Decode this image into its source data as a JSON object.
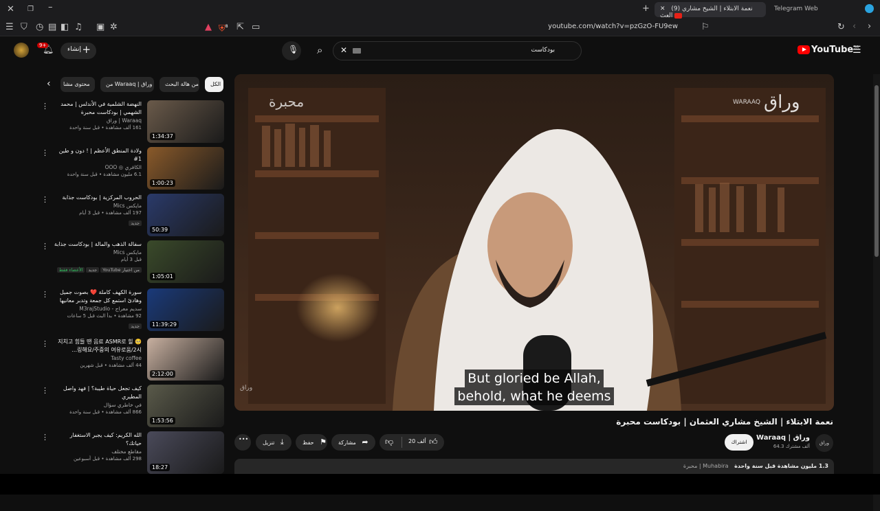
{
  "browser": {
    "tabs": [
      {
        "title": "(9) نعمة الابتلاء | الشيخ مشاري العث",
        "active": true
      },
      {
        "title": "Telegram Web",
        "active": false
      }
    ],
    "url": "youtube.com/watch?v=pzGzO-FU9ew",
    "brave_badge": "8"
  },
  "masthead": {
    "search_query": "بودكاست",
    "create_label": "إنشاء",
    "notif_count": "9+",
    "logo_text": "YouTube",
    "logo_region": "SA"
  },
  "chips": [
    "الكل",
    "من هالة البحث",
    "من Waraaq | وراق",
    "محتوى مشا"
  ],
  "related": [
    {
      "title": "النهضة الشلمية في الأندلس | محمد الشهمي | بودكاست محبرة",
      "channel": "Waraaq | وراق",
      "stats": "161 ألف مشاهدة • قبل سنة واحدة",
      "duration": "1:34:37",
      "badges": [],
      "color": "#6a5a4a"
    },
    {
      "title": "ولادة المنطق الأعظم | ! دون و طين 1#",
      "channel": "الكافري ◎ OOO",
      "stats": "6.1 مليون مشاهدة • قبل سنة واحدة",
      "duration": "1:00:23",
      "badges": [],
      "color": "#8a5a2a"
    },
    {
      "title": "الحروب المركزية | بودكاست جذابة",
      "channel": "مايكس Mics",
      "stats": "197 ألف مشاهدة • قبل 3 أيام",
      "duration": "50:39",
      "badges": [
        "جديد"
      ],
      "color": "#2a3a6a"
    },
    {
      "title": "سفالة الذهب والمالة | بودكاست جذابة",
      "channel": "مايكس Mics",
      "stats": "قبل 3 أيام",
      "duration": "1:05:01",
      "badges": [
        "من اختيار YouTube",
        "جديد",
        "الأعضاء فقط"
      ],
      "color": "#3a4a2a"
    },
    {
      "title": "سورة الكهف كاملة ❤️ بصوت جميل وهادئ استمع كل جمعة وتدبر معانيها 🌿 Surah...",
      "channel": "سديم معراج - M3rajStudio",
      "stats": "92 مشاهدة • بدأ البث قبل 5 ساعات",
      "duration": "11:39:29",
      "badges": [
        "جديد"
      ],
      "color": "#1a3a7a"
    },
    {
      "title": "🥺 지치고 힘들 땐 음료 ASMR로 힐링해요/주중의 여유로움/2시...",
      "channel": "Tasty coffee",
      "stats": "44 ألف مشاهدة • قبل شهرين",
      "duration": "2:12:00",
      "badges": [],
      "color": "#c8b0a0"
    },
    {
      "title": "كيف تجعل حياة طيبة؟ | فهد واصل المطيري",
      "channel": "في خاطري سؤال",
      "stats": "866 ألف مشاهدة • قبل سنة واحدة",
      "duration": "1:53:56",
      "badges": [],
      "color": "#5a5a4a"
    },
    {
      "title": "الله الكريم: كيف يجبر الاستغفار حياتك؟",
      "channel": "مقاطع مختلف",
      "stats": "298 ألف مشاهدة • قبل أسبوعين",
      "duration": "18:27",
      "badges": [],
      "color": "#4a4a5a"
    }
  ],
  "player": {
    "caption_lines": [
      "But gloried be Allah,",
      "behold, what he deems"
    ],
    "watermark_left": "محبرة",
    "watermark_right": "وراق",
    "watermark_right_en": "WARAAQ",
    "watermark_small": "وراق"
  },
  "video": {
    "title": "نعمة الابتلاء | الشيخ مشاري العثمان | بودكاست محبرة",
    "channel_name": "Waraaq | وراق",
    "subscribers": "64.3 ألف مشترك",
    "channel_logo_text": "وراق",
    "subscribe_label": "اشتراك",
    "like_count": "20 ألف",
    "share_label": "مشاركة",
    "save_label": "حفظ",
    "download_label": "تنزيل",
    "description_views": "1.3 مليون مشاهدة قبل سنة واحدة",
    "description_tags": "Muhabira | محبرة"
  }
}
